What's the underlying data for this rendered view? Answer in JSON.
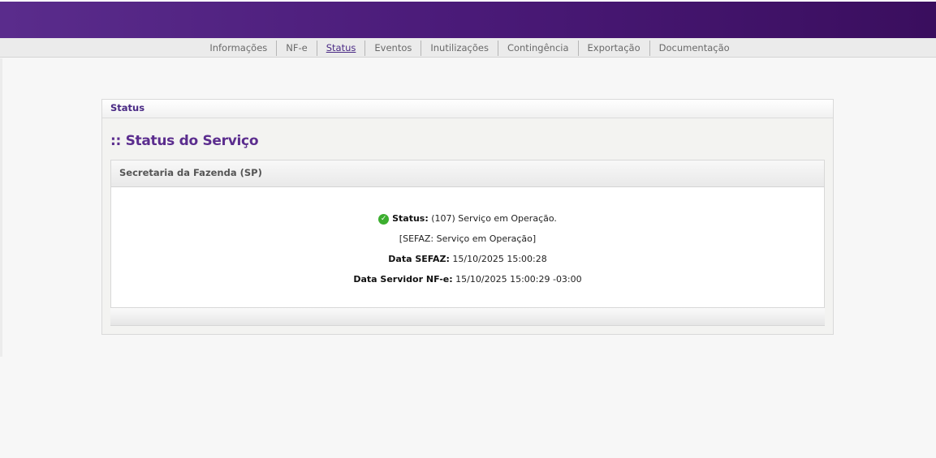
{
  "nav": {
    "items": [
      {
        "label": "Informações"
      },
      {
        "label": "NF-e"
      },
      {
        "label": "Status"
      },
      {
        "label": "Eventos"
      },
      {
        "label": "Inutilizações"
      },
      {
        "label": "Contingência"
      },
      {
        "label": "Exportação"
      },
      {
        "label": "Documentação"
      }
    ],
    "active": "Status"
  },
  "panel": {
    "header": "Status",
    "title": ":: Status do Serviço",
    "box_header": "Secretaria da Fazenda (SP)",
    "status_label": "Status:",
    "status_value": "(107) Serviço em Operação.",
    "sefaz_message": "[SEFAZ: Serviço em Operação]",
    "data_sefaz_label": "Data SEFAZ:",
    "data_sefaz_value": "15/10/2025 15:00:28",
    "data_servidor_label": "Data Servidor NF-e:",
    "data_servidor_value": "15/10/2025 15:00:29 -03:00"
  },
  "colors": {
    "brand": "#4a1a78",
    "accent": "#5b2d8e",
    "success": "#3cae2f"
  },
  "icons": {
    "status": "check-circle-icon"
  }
}
